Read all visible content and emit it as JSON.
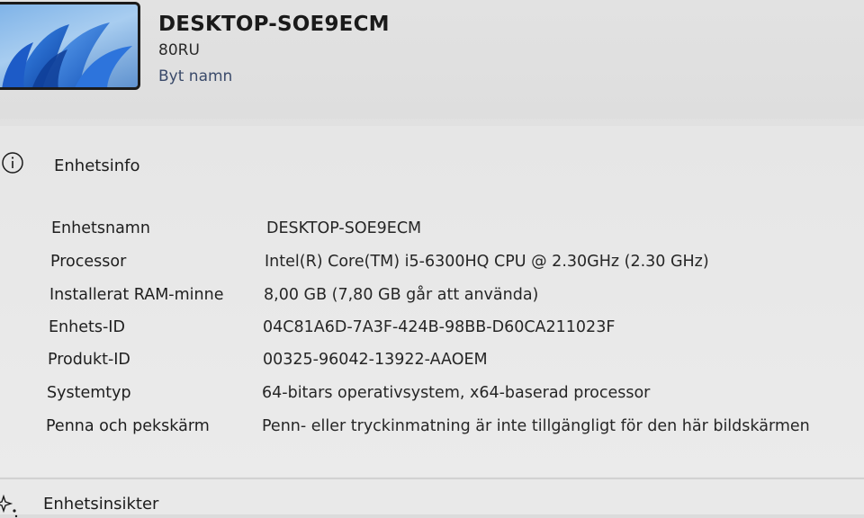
{
  "header": {
    "device_name": "DESKTOP-SOE9ECM",
    "model": "80RU",
    "rename_label": "Byt namn"
  },
  "device_info": {
    "title": "Enhetsinfo",
    "icon": "info-icon",
    "rows": [
      {
        "label": "Enhetsnamn",
        "value": "DESKTOP-SOE9ECM"
      },
      {
        "label": "Processor",
        "value": "Intel(R) Core(TM) i5-6300HQ CPU @ 2.30GHz (2.30 GHz)"
      },
      {
        "label": "Installerat RAM-minne",
        "value": "8,00 GB (7,80 GB går att använda)"
      },
      {
        "label": "Enhets-ID",
        "value": "04C81A6D-7A3F-424B-98BB-D60CA211023F"
      },
      {
        "label": "Produkt-ID",
        "value": "00325-96042-13922-AAOEM"
      },
      {
        "label": "Systemtyp",
        "value": "64-bitars operativsystem, x64-baserad processor"
      },
      {
        "label": "Penna och pekskärm",
        "value": "Penn- eller tryckinmatning är inte tillgängligt för den här bildskärmen"
      }
    ]
  },
  "device_specs": {
    "title": "Enhetsinsikter",
    "icon": "sparkle-icon"
  },
  "colors": {
    "background": "#e6e6e6",
    "text": "#1a1a1a",
    "wallpaper_blue": "#1f5fc4"
  }
}
